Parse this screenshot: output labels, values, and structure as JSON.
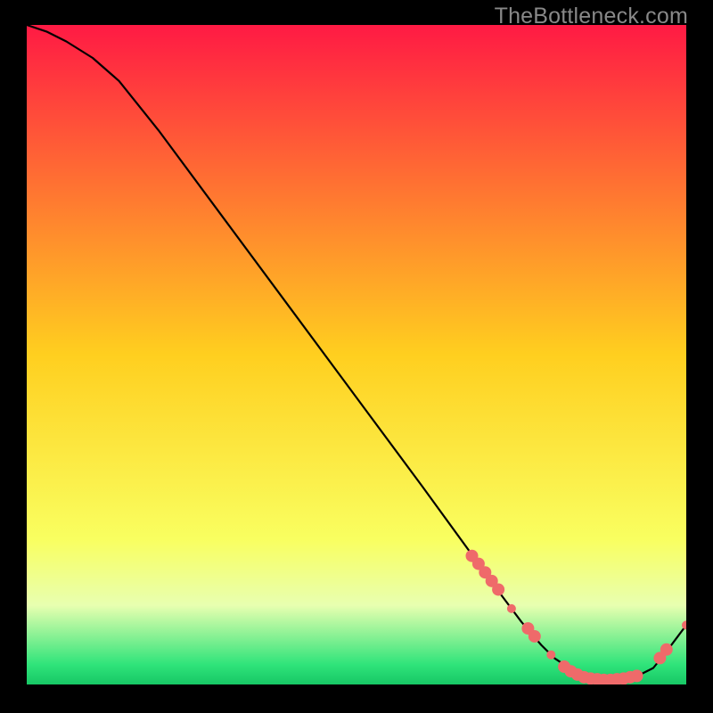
{
  "watermark": "TheBottleneck.com",
  "chart_data": {
    "type": "line",
    "title": "",
    "xlabel": "",
    "ylabel": "",
    "xlim": [
      0,
      100
    ],
    "ylim": [
      0,
      100
    ],
    "grid": false,
    "legend": false,
    "background_gradient": {
      "stops": [
        {
          "offset": 0.0,
          "color": "#ff1a44"
        },
        {
          "offset": 0.5,
          "color": "#ffcf1f"
        },
        {
          "offset": 0.78,
          "color": "#f9ff60"
        },
        {
          "offset": 0.88,
          "color": "#e8ffb0"
        },
        {
          "offset": 0.97,
          "color": "#2fe47a"
        },
        {
          "offset": 1.0,
          "color": "#17c765"
        }
      ]
    },
    "series": [
      {
        "name": "bottleneck-curve",
        "color": "#000000",
        "x": [
          0,
          3,
          6,
          10,
          14,
          20,
          30,
          40,
          50,
          60,
          68,
          72,
          75,
          78,
          80,
          83,
          86,
          89,
          92,
          95,
          97,
          100
        ],
        "y": [
          100,
          99,
          97.5,
          95,
          91.5,
          84,
          70.5,
          57,
          43.5,
          30,
          19,
          13.5,
          9.5,
          6,
          4,
          2,
          1,
          0.7,
          1,
          2.5,
          5,
          9
        ]
      }
    ],
    "markers": {
      "color": "#ef6a6a",
      "points": [
        {
          "x": 67.5,
          "y": 19.5,
          "r": 7
        },
        {
          "x": 68.5,
          "y": 18.3,
          "r": 7
        },
        {
          "x": 69.5,
          "y": 17.0,
          "r": 7
        },
        {
          "x": 70.5,
          "y": 15.7,
          "r": 7
        },
        {
          "x": 71.5,
          "y": 14.4,
          "r": 7
        },
        {
          "x": 73.5,
          "y": 11.5,
          "r": 5
        },
        {
          "x": 76.0,
          "y": 8.5,
          "r": 7
        },
        {
          "x": 77.0,
          "y": 7.3,
          "r": 7
        },
        {
          "x": 79.5,
          "y": 4.5,
          "r": 5
        },
        {
          "x": 81.5,
          "y": 2.7,
          "r": 7
        },
        {
          "x": 82.5,
          "y": 2.0,
          "r": 7
        },
        {
          "x": 83.5,
          "y": 1.5,
          "r": 7
        },
        {
          "x": 84.5,
          "y": 1.1,
          "r": 7
        },
        {
          "x": 85.5,
          "y": 0.9,
          "r": 7
        },
        {
          "x": 86.5,
          "y": 0.8,
          "r": 7
        },
        {
          "x": 87.5,
          "y": 0.7,
          "r": 7
        },
        {
          "x": 88.5,
          "y": 0.7,
          "r": 7
        },
        {
          "x": 89.5,
          "y": 0.8,
          "r": 7
        },
        {
          "x": 90.5,
          "y": 0.9,
          "r": 7
        },
        {
          "x": 91.5,
          "y": 1.1,
          "r": 7
        },
        {
          "x": 92.5,
          "y": 1.3,
          "r": 7
        },
        {
          "x": 96.0,
          "y": 4.0,
          "r": 7
        },
        {
          "x": 97.0,
          "y": 5.3,
          "r": 7
        },
        {
          "x": 100.0,
          "y": 9.0,
          "r": 5
        }
      ]
    }
  }
}
